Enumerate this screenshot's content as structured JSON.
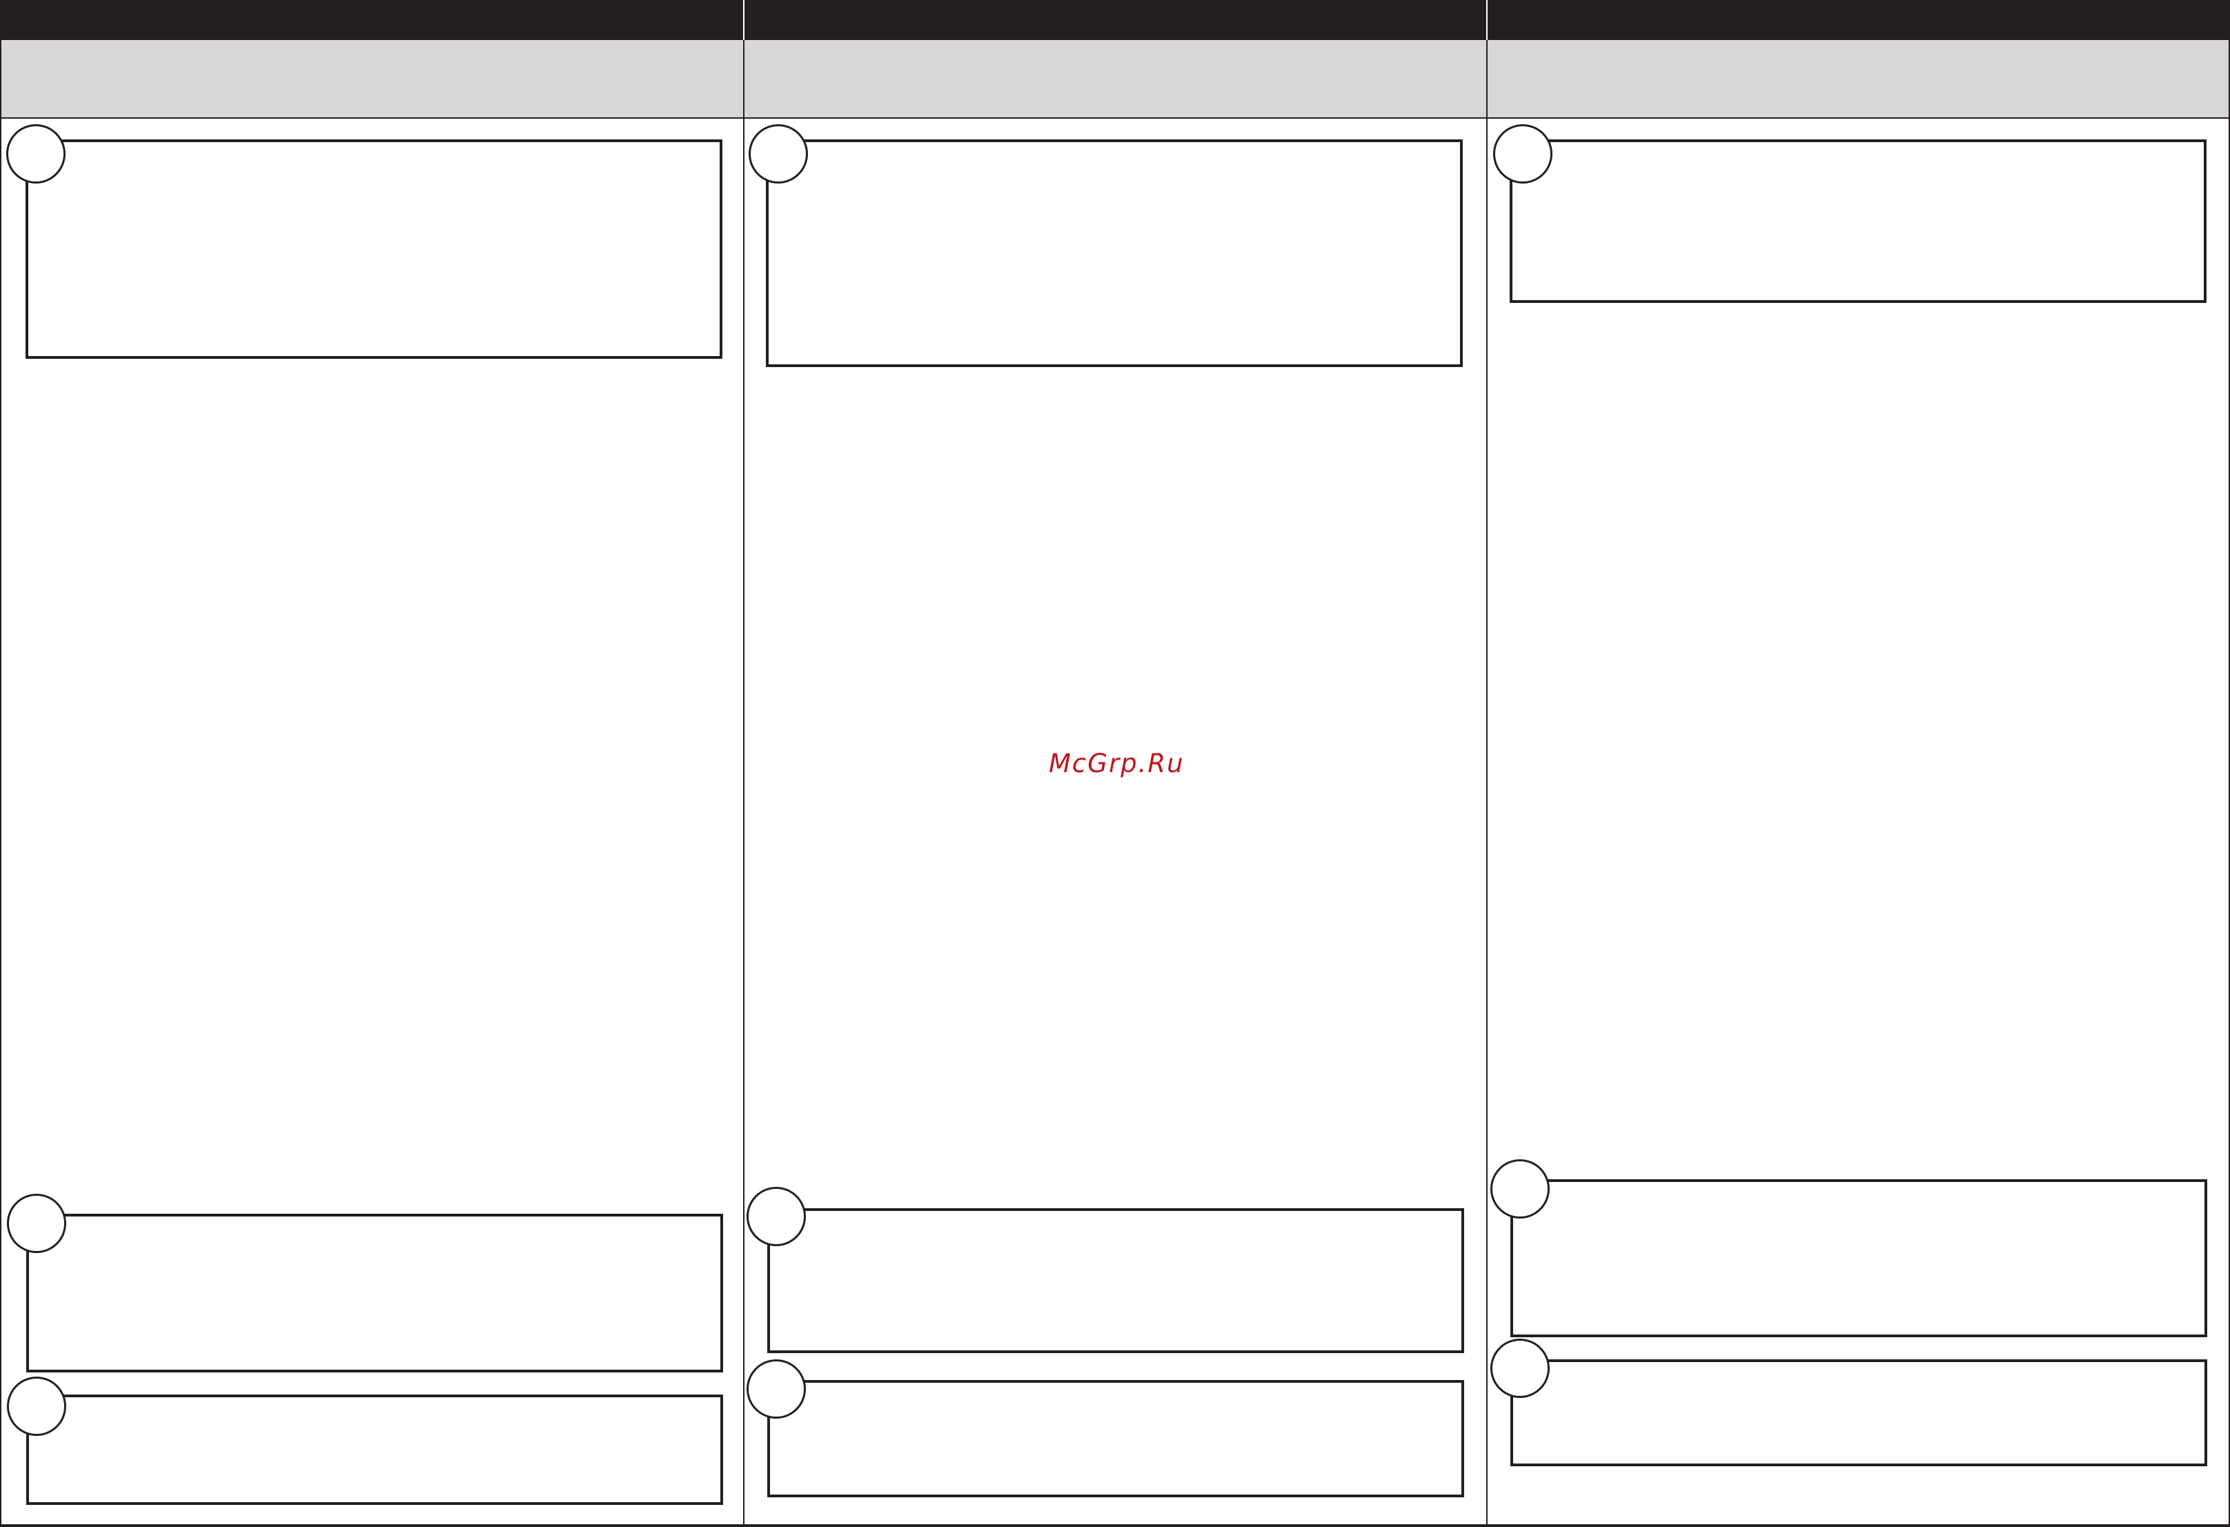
{
  "watermark": {
    "text": "McGrp.Ru"
  },
  "columns": [
    {
      "steps": [
        {},
        {},
        {}
      ]
    },
    {
      "steps": [
        {},
        {},
        {}
      ]
    },
    {
      "steps": [
        {},
        {},
        {}
      ]
    }
  ],
  "colors": {
    "header_bar": "#231f20",
    "subheader": "#d6d7d9",
    "line": "#231f20",
    "watermark": "#c0141c"
  }
}
